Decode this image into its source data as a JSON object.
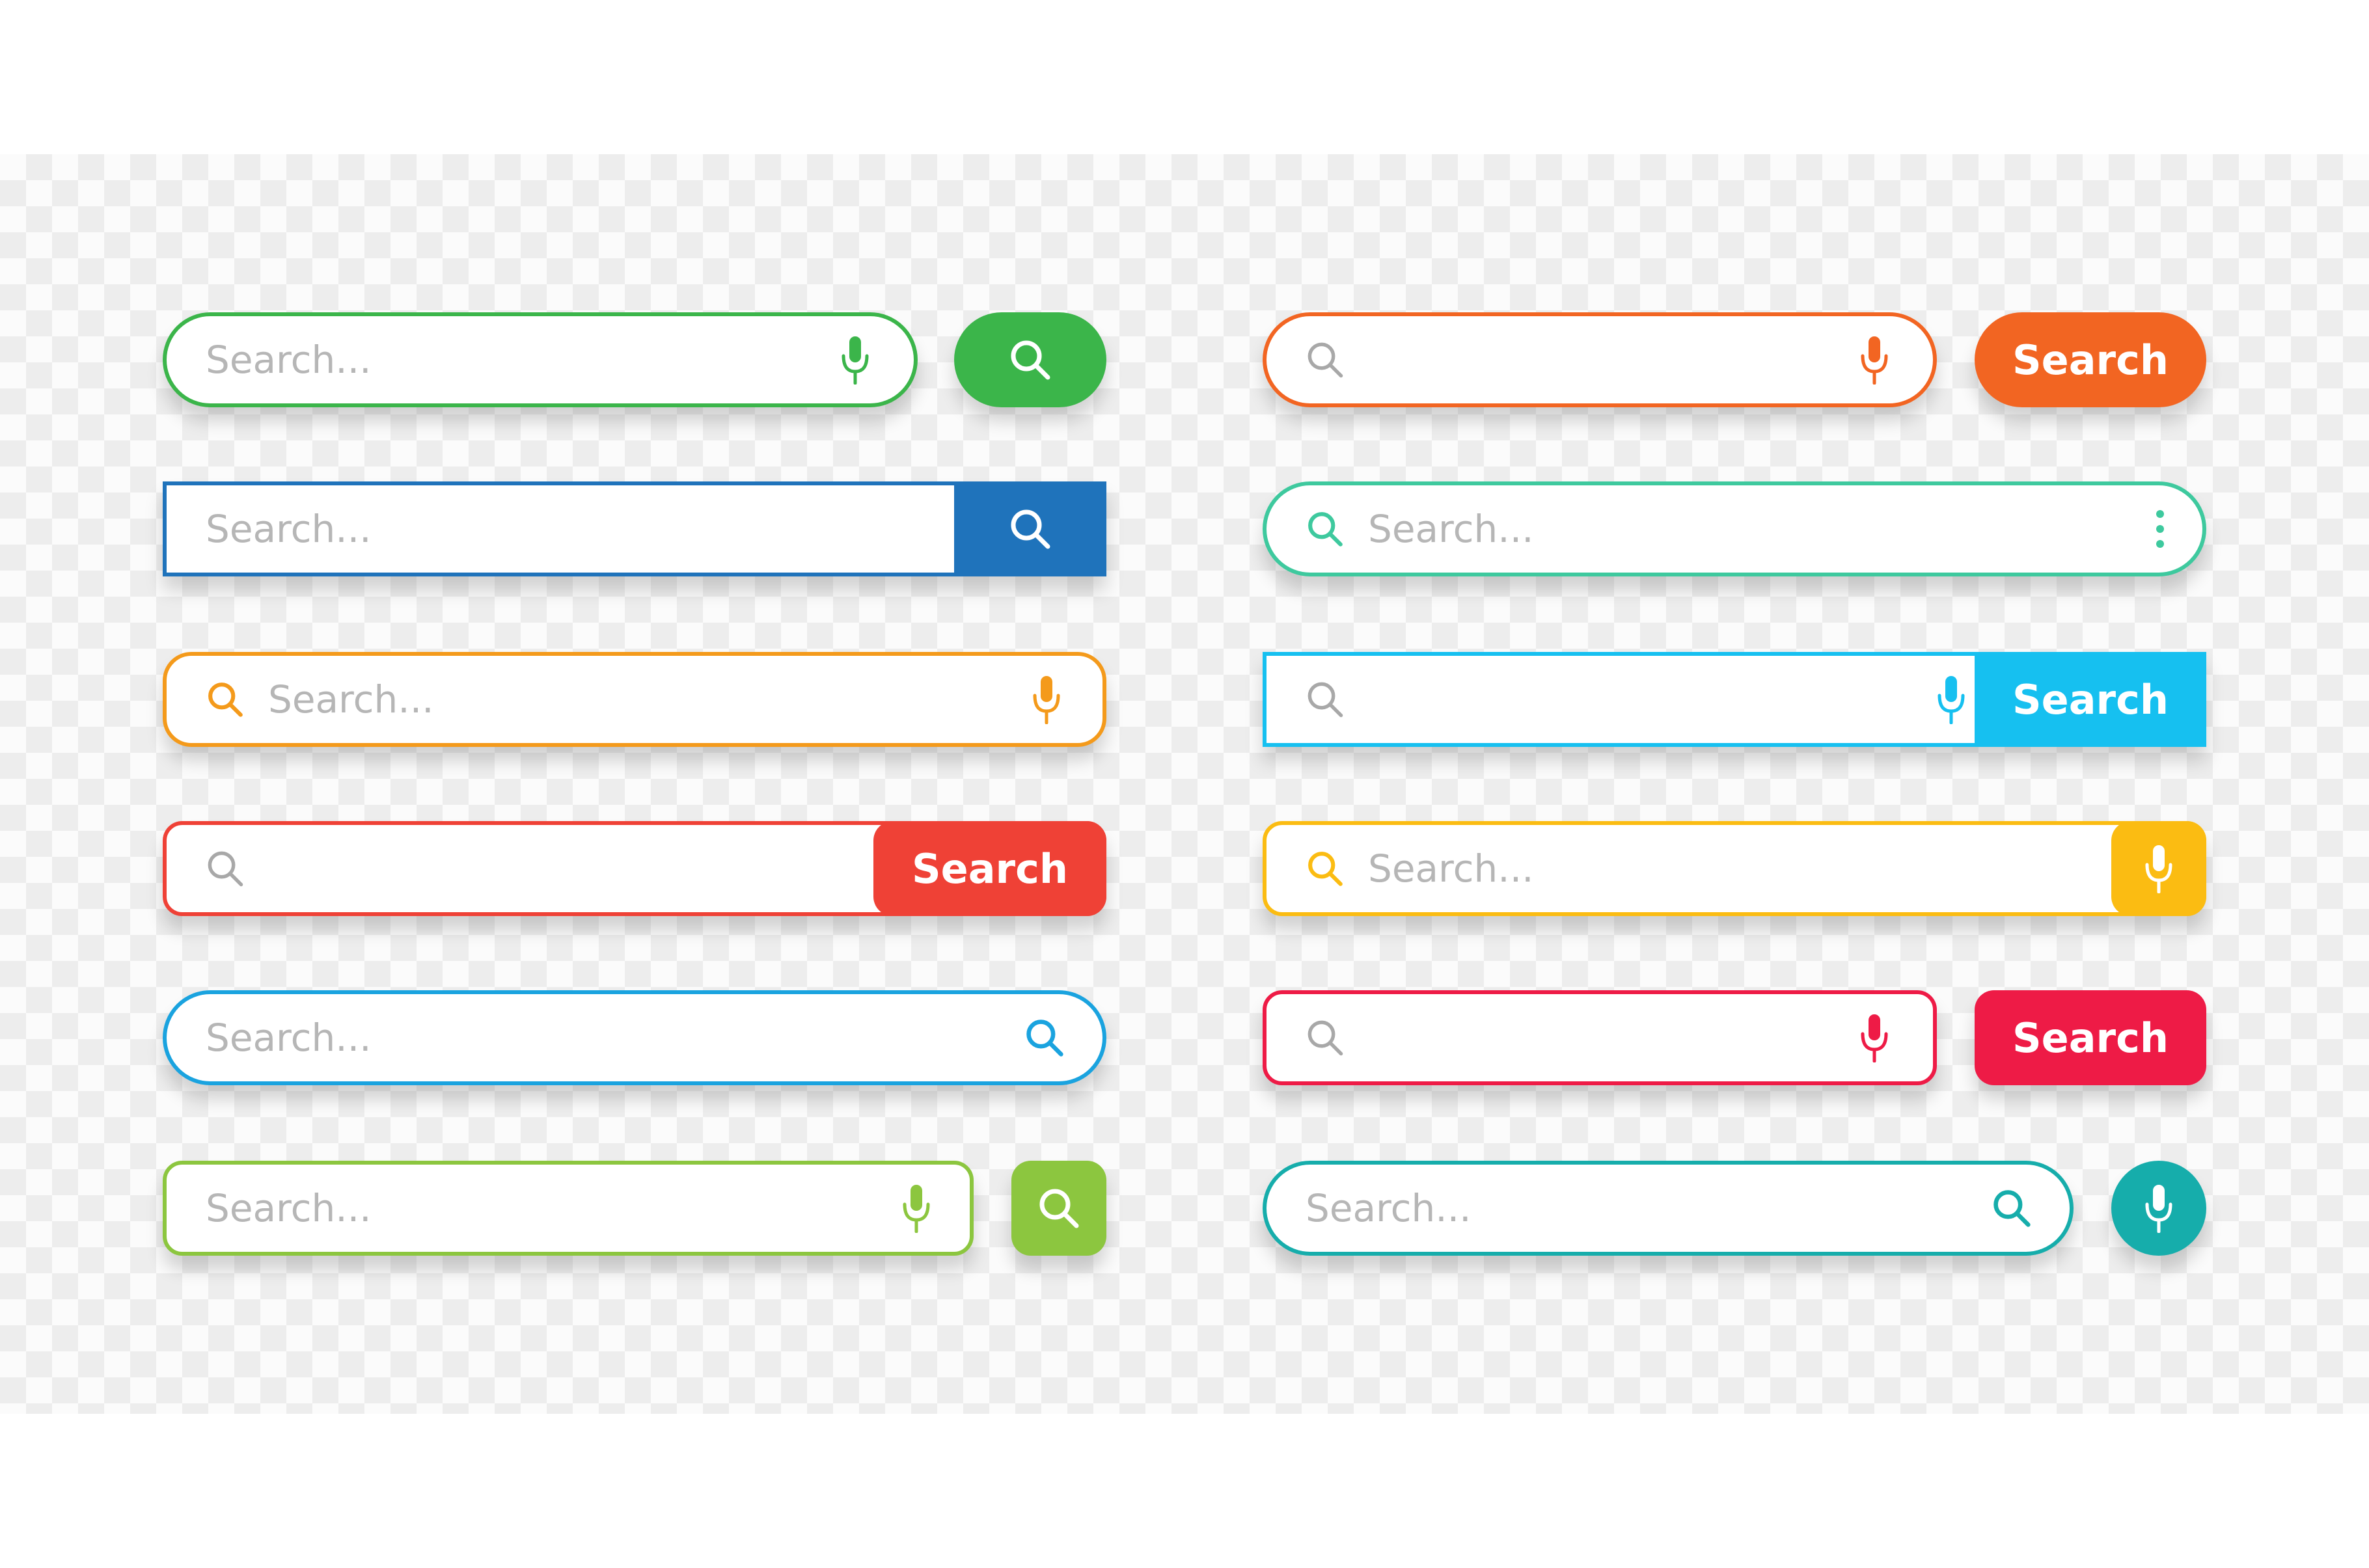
{
  "placeholder": "Search...",
  "search_label": "Search",
  "icons": {
    "search": "search-icon",
    "mic": "microphone-icon",
    "more": "more-vertical-icon"
  },
  "colors": {
    "green": "#3bb54a",
    "blue": "#1f73bb",
    "orange": "#f49a1b",
    "red": "#ef4136",
    "sky": "#1aa3df",
    "lime": "#8cc63f",
    "deep_orange": "#f26522",
    "mint": "#3ec99e",
    "cyan": "#16c0f0",
    "yellow": "#fbbc12",
    "crimson": "#ee1b46",
    "teal": "#16adab",
    "placeholder": "#b6b6b6",
    "icon_gray": "#a8a8a8"
  }
}
